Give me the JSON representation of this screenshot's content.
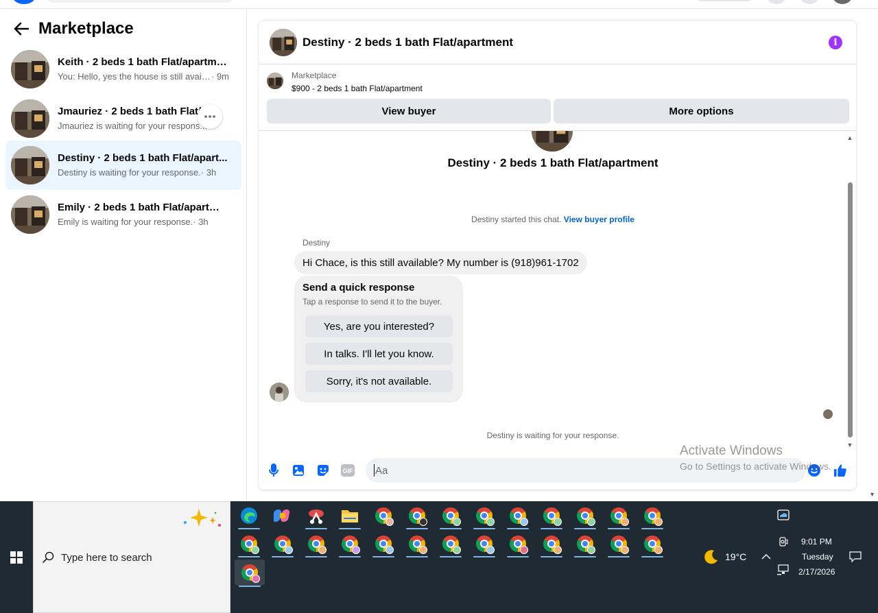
{
  "sidebar": {
    "title": "Marketplace",
    "conversations": [
      {
        "name": "Keith · 2 beds 1 bath Flat/apartment",
        "snippet": "You: Hello, yes the house is still availa...",
        "time": " · 9m"
      },
      {
        "name": "Jmauriez · 2 beds 1 bath Flat/ap...",
        "snippet": "Jmauriez is waiting for your respons...",
        "time": ""
      },
      {
        "name": "Destiny · 2 beds 1 bath Flat/apart...",
        "snippet": "Destiny is waiting for your response.",
        "time": " · 3h"
      },
      {
        "name": "Emily · 2 beds 1 bath Flat/apartment",
        "snippet": "Emily is waiting for your response.",
        "time": " · 3h"
      }
    ]
  },
  "chat": {
    "title": "Destiny · 2 beds 1 bath Flat/apartment",
    "listing_label": "Marketplace",
    "listing_price": "$900 - 2 beds 1 bath Flat/apartment",
    "view_buyer": "View buyer",
    "more_options": "More options",
    "big_title": "Destiny · 2 beds 1 bath Flat/apartment",
    "started_text": "Destiny started this chat.",
    "view_buyer_profile": "View buyer profile",
    "sender": "Destiny",
    "message": "Hi Chace, is this still available? My number is (918)961-1702",
    "quick_title": "Send a quick response",
    "quick_sub": "Tap a response to send it to the buyer.",
    "quick_responses": [
      "Yes, are you interested?",
      "In talks. I'll let you know.",
      "Sorry, it's not available."
    ],
    "waiting": "Destiny is waiting for your response.",
    "input_placeholder": "Aa",
    "gif_label": "GIF"
  },
  "watermark": {
    "line1": "Activate Windows",
    "line2": "Go to Settings to activate Windows."
  },
  "taskbar": {
    "search_placeholder": "Type here to search",
    "weather": "19°C",
    "time": "9:01 PM",
    "day": "Tuesday",
    "date": "2/17/2026"
  },
  "colors": {
    "accent": "#0866ff",
    "active_conv": "#ebf5ff",
    "info": "#a033ff",
    "link": "#0064d1"
  }
}
